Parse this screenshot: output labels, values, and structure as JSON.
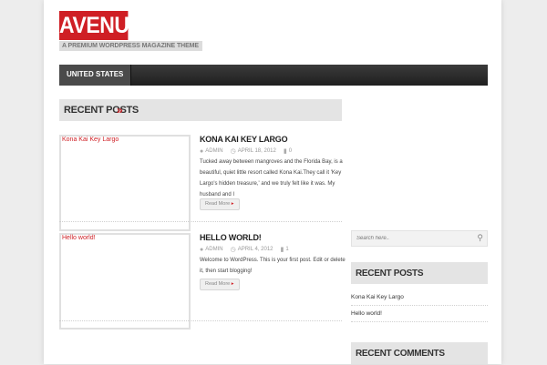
{
  "site": {
    "logo": "AVENUE",
    "tagline": "A Premium WordPress Magazine Theme"
  },
  "nav": {
    "items": [
      {
        "label": "United States"
      }
    ]
  },
  "section": {
    "title": "Recent Posts",
    "arrow": "»"
  },
  "posts": [
    {
      "thumb_alt": "Kona Kai Key Largo",
      "title": "Kona Kai Key Largo",
      "author": "ADMIN",
      "date": "APRIL 18, 2012",
      "comments": "0",
      "excerpt": "Tucked away between mangroves and the Florida Bay, is a beautiful, quiet little resort called Kona Kai.They call it 'Key Largo's hidden treasure,' and we truly felt like it was. My husband and I",
      "read_more": "Read More"
    },
    {
      "thumb_alt": "Hello world!",
      "title": "Hello world!",
      "author": "ADMIN",
      "date": "APRIL 4, 2012",
      "comments": "1",
      "excerpt": "Welcome to WordPress. This is your first post. Edit or delete it, then start blogging!",
      "read_more": "Read More"
    }
  ],
  "sidebar": {
    "search_placeholder": "Search here..",
    "recent_posts": {
      "title": "Recent Posts",
      "items": [
        "Kona Kai Key Largo",
        "Hello world!"
      ]
    },
    "recent_comments": {
      "title": "Recent Comments"
    }
  },
  "colors": {
    "accent": "#cf1f25",
    "nav_bg": "#2b2b2b",
    "section_bg": "#e4e4e4"
  },
  "icons": {
    "author": "user-icon",
    "date": "clock-icon",
    "comments": "comment-icon",
    "search": "search-icon",
    "read_more": "arrow-right-icon"
  }
}
